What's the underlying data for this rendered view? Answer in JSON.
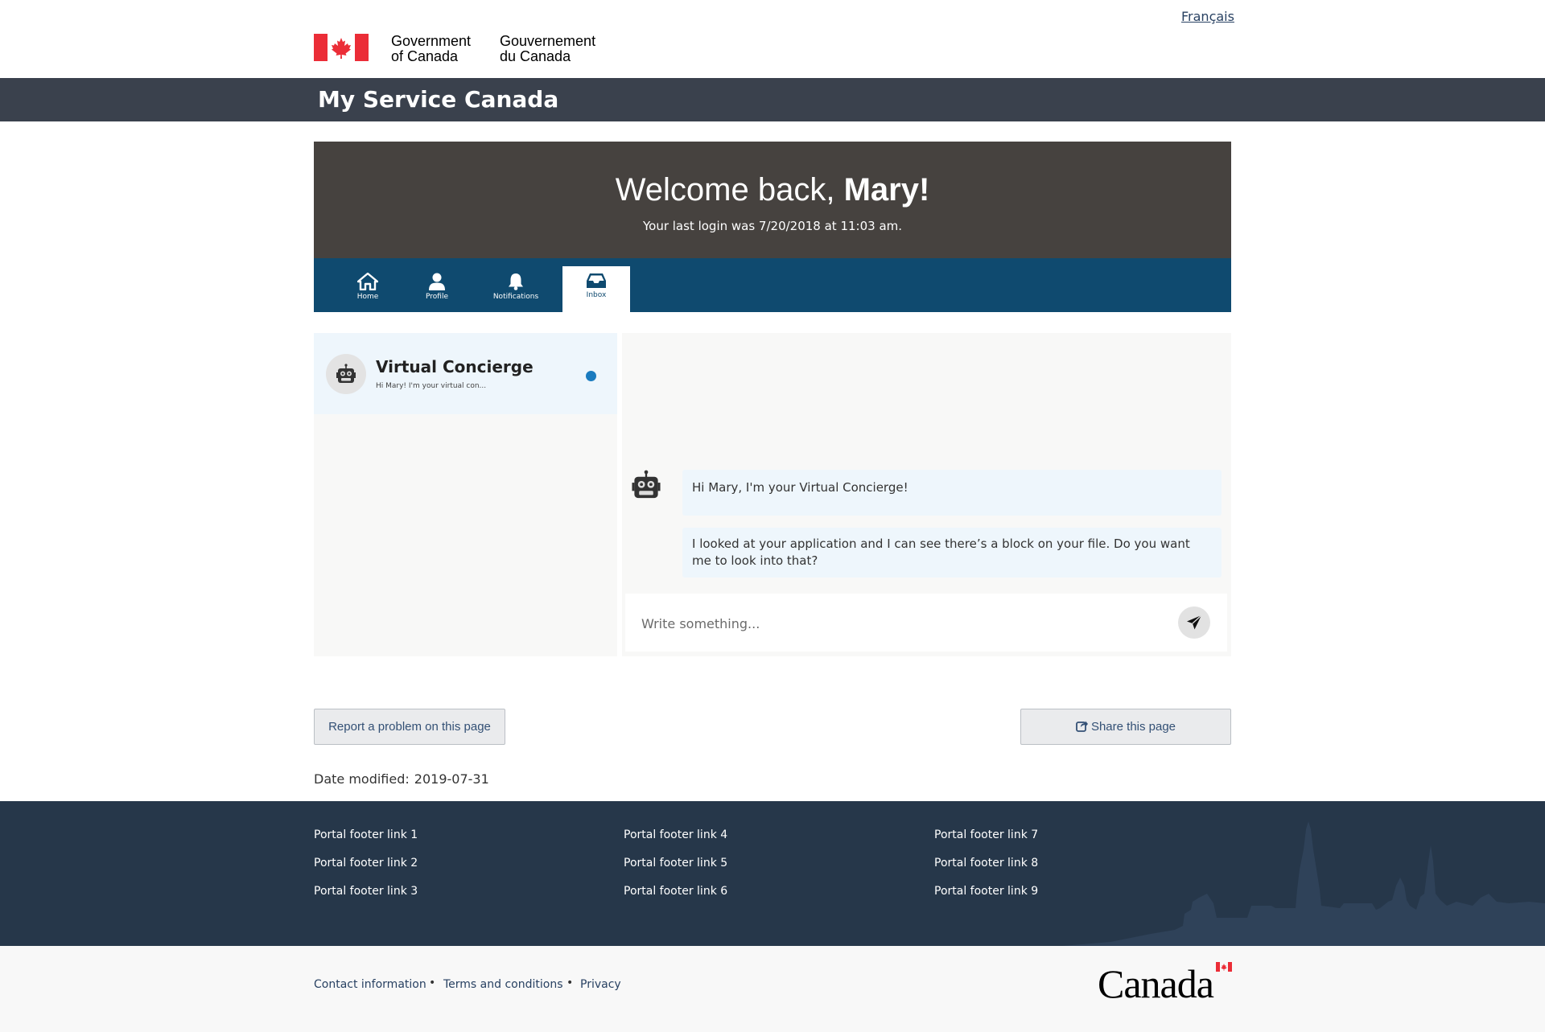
{
  "header": {
    "language_link": "Français",
    "signature_en": "Government\nof Canada",
    "signature_fr": "Gouvernement\ndu Canada",
    "app_title": "My Service Canada"
  },
  "banner": {
    "welcome_prefix": "Welcome back,",
    "welcome_name": "Mary!",
    "last_login": "Your last login was 7/20/2018 at 11:03 am."
  },
  "nav": {
    "tabs": [
      {
        "label": "Home",
        "icon": "home-icon"
      },
      {
        "label": "Profile",
        "icon": "user-icon"
      },
      {
        "label": "Notifications",
        "icon": "bell-icon"
      },
      {
        "label": "Inbox",
        "icon": "inbox-icon",
        "active": true
      }
    ]
  },
  "inbox": {
    "conversations": [
      {
        "name": "Virtual Concierge",
        "preview": "Hi Mary! I'm your virtual con...",
        "unread": true,
        "icon": "robot-icon"
      }
    ],
    "messages": [
      {
        "text": "Hi Mary, I'm your Virtual Concierge!"
      },
      {
        "text": "I looked at your application and I can see there’s a block on your file. Do you want me to look into that?"
      }
    ],
    "composer_placeholder": "Write something..."
  },
  "actions": {
    "report": "Report a problem on this page",
    "share": "Share this page"
  },
  "date_modified": {
    "label": "Date modified:",
    "value": "2019-07-31"
  },
  "footer": {
    "links": [
      "Portal footer link 1",
      "Portal footer link 2",
      "Portal footer link 3",
      "Portal footer link 4",
      "Portal footer link 5",
      "Portal footer link 6",
      "Portal footer link 7",
      "Portal footer link 8",
      "Portal footer link 9"
    ],
    "sub_links": [
      "Contact information",
      "Terms and conditions",
      "Privacy"
    ],
    "separator": "•",
    "wordmark": "Canada"
  },
  "colors": {
    "app_bar": "#3a414d",
    "banner": "#46423f",
    "nav": "#0f4a6f",
    "footer": "#26374a",
    "flag_red": "#eb2d37",
    "unread_dot": "#1a7bbf"
  }
}
